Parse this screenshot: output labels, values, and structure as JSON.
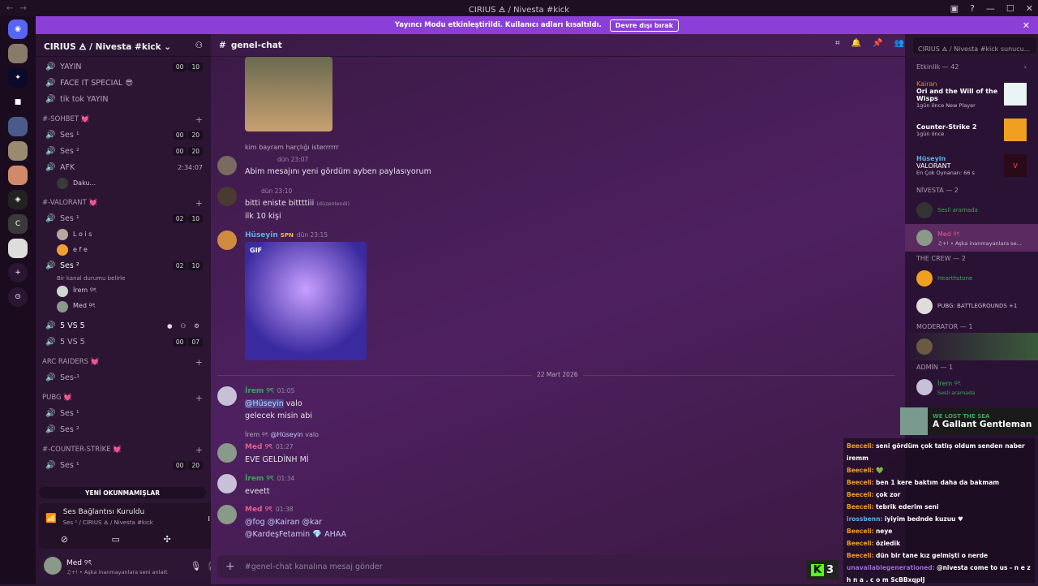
{
  "window": {
    "title": "CIRIUS 🜁 / Nivesta #kick"
  },
  "banner": {
    "text": "Yayıncı Modu etkinleştirildi. Kullanıcı adları kısaltıldı.",
    "button": "Devre dışı bırak"
  },
  "sidebar": {
    "server_name": "CIRIUS 🜁 / Nivesta #kick",
    "top_channels": [
      {
        "name": "YAYIN",
        "c1": "00",
        "c2": "10"
      },
      {
        "name": "FACE IT SPECIAL 😎"
      },
      {
        "name": "tik tok YAYIN"
      }
    ],
    "cat_sohbet": "#-SOHBET 💓",
    "sohbet_channels": [
      {
        "name": "Ses ¹",
        "c1": "00",
        "c2": "20"
      },
      {
        "name": "Ses ²",
        "c1": "00",
        "c2": "20"
      },
      {
        "name": "AFK",
        "timer": "2:34:07"
      }
    ],
    "afk_user": "Daku...",
    "cat_valorant": "#-VALORANT 💓",
    "val_ses1": {
      "name": "Ses ¹",
      "c1": "02",
      "c2": "10"
    },
    "val_ses1_users": [
      "L o i s",
      "e f e"
    ],
    "val_ses2": {
      "name": "Ses ²",
      "c1": "02",
      "c2": "10"
    },
    "val_ses2_status": "Bir kanal durumu belirle",
    "val_ses2_users": [
      "İrem ୨ৎ",
      "Med ୨ৎ"
    ],
    "vs_channels": [
      {
        "name": "5 VS 5"
      },
      {
        "name": "5 VS 5",
        "c1": "00",
        "c2": "07"
      }
    ],
    "cat_arc": "ARC RAIDERS 💓",
    "arc_channels": [
      "Ses-¹"
    ],
    "cat_pubg": "PUBG 💓",
    "pubg_channels": [
      "Ses ¹",
      "Ses ²"
    ],
    "cat_cs": "#-COUNTER-STRİKE 💓",
    "cs_channels": [
      {
        "name": "Ses ¹",
        "c1": "00",
        "c2": "20"
      }
    ],
    "unread_pill": "YENİ OKUNMAMIŞLAR",
    "voice_status": "Ses Bağlantısı Kuruldu",
    "voice_channel": "Ses ² / CIRIUS 🜁 / Nivesta #kick",
    "user_name": "Med ୨ৎ",
    "user_status": "♫+! • Aşka inanmayanlara seni anlatt"
  },
  "chat": {
    "channel": "genel-chat",
    "search_placeholder": "CIRIUS 🜁 / Nivesta #kick sunucu...",
    "reply1": "kim bayram harçlığı isterrrrrr",
    "msg1_time": "dün 23:07",
    "msg1_text": "Abim mesajını yeni gördüm ayben paylasıyorum",
    "msg2_time": "dün 23:10",
    "msg2_text": "bitti eniste bittttiii",
    "msg2_edited": "(düzenlendi)",
    "msg2_text2": "ilk 10 kişi",
    "msg3_name": "Hüseyin",
    "msg3_tag": "SPN",
    "msg3_time": "dün 23:15",
    "gif_label": "GIF",
    "date_divider": "22 Mart 2026",
    "msg4_name": "İrem ୨ৎ",
    "msg4_time": "01:05",
    "msg4_mention": "@Hüseyin",
    "msg4_text": "valo",
    "msg4_text2": "gelecek misin abi",
    "reply2_name": "İrem ୨ৎ",
    "reply2_mention": "@Hüseyin",
    "reply2_text": "valo",
    "msg5_name": "Med ୨ৎ",
    "msg5_time": "01:27",
    "msg5_text": "EVE GELDİNH Mİ",
    "msg6_name": "İrem ୨ৎ",
    "msg6_time": "01:34",
    "msg6_text": "eveett",
    "msg7_name": "Med ୨ৎ",
    "msg7_time": "01:38",
    "msg7_line1": "@fog  @Kairan  @kar",
    "msg7_line2": "@KardeşFetamin 💎 AHAA",
    "input_placeholder": "#genel-chat kanalına mesaj gönder"
  },
  "members": {
    "activity_header": "Etkinlik — 42",
    "act1_user": "Kairan",
    "act1_game": "Ori and the Will of the Wisps",
    "act1_sub": "1gün önce  New Player",
    "act2_game": "Counter-Strike 2",
    "act2_sub": "1gün önce",
    "act3_user": "Hüseyin",
    "act3_game": "VALORANT",
    "act3_sub": "En Çok Oynanan: 66 s",
    "cat_nivesta": "NİVESTA — 2",
    "niv1_sub": "Sesli aramada",
    "niv2_name": "Med ୨ৎ",
    "niv2_sub": "♫+! • Aşka inanmayanlara se...",
    "cat_crew": "THE CREW — 2",
    "crew1_sub": "Hearthstone",
    "crew2_sub": "PUBG: BATTLEGROUNDS +1",
    "cat_mod": "MODERATOR — 1",
    "cat_admin": "ADMİN — 1",
    "admin1_name": "İrem ୨ৎ",
    "admin1_sub": "Sesli aramada"
  },
  "overlay": {
    "now_playing_label": "WE LOST THE SEA",
    "now_playing_title": "A Gallant Gentleman",
    "messages": [
      {
        "name": "Beeceli:",
        "text": "seni gördüm çok tatlış oldum senden naber iremm"
      },
      {
        "name": "Beeceli:",
        "text": "💚"
      },
      {
        "name": "Beeceli:",
        "text": "ben 1 kere baktım daha da bakmam"
      },
      {
        "name": "Beeceli:",
        "text": "çok zor"
      },
      {
        "name": "Beeceli:",
        "text": "tebrik ederim seni"
      },
      {
        "name": "irossbenn:",
        "text": "iyiyim bednde kuzuu ♥"
      },
      {
        "name": "Beeceli:",
        "text": "neye"
      },
      {
        "name": "Beeceli:",
        "text": "özledik"
      },
      {
        "name": "Beeceli:",
        "text": "dün bir tane kız gelmişti o nerde"
      },
      {
        "name": "unavailablegenerationed:",
        "text": "@nivesta come to us - n e z h n a . c o m ScBBxqplJ"
      }
    ],
    "kick_count": "3"
  }
}
